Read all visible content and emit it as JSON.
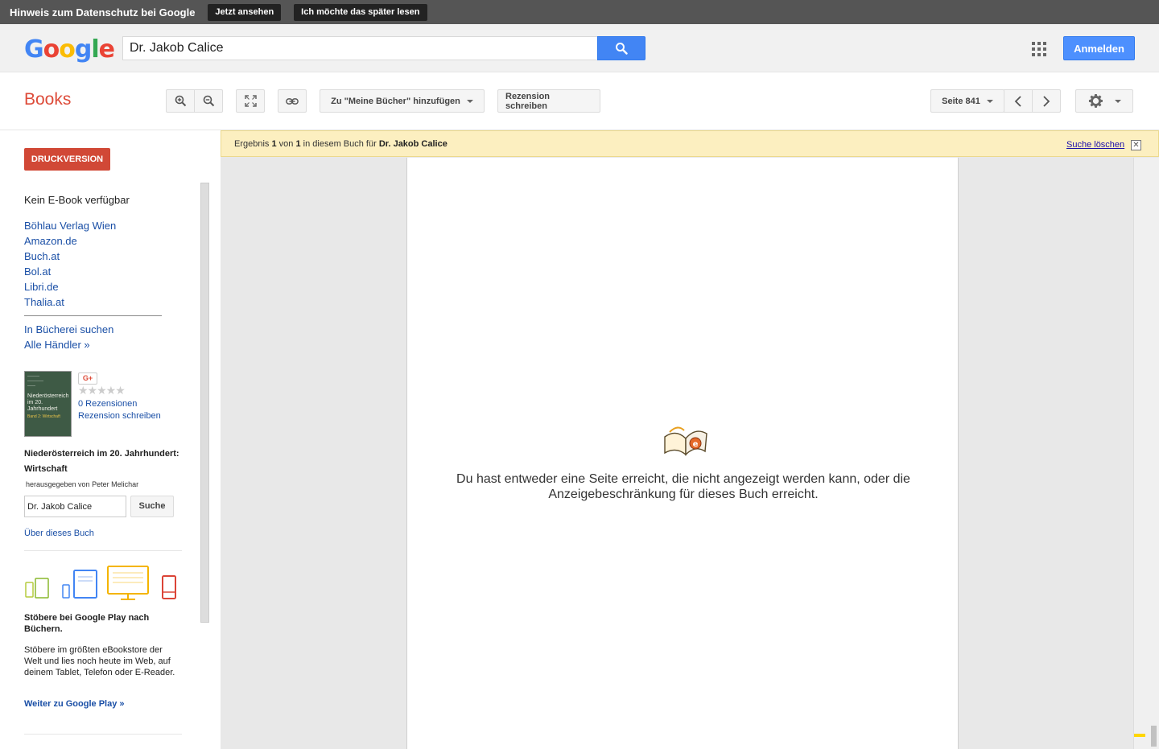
{
  "privacy": {
    "text": "Hinweis zum Datenschutz bei Google",
    "view_now": "Jetzt ansehen",
    "later": "Ich möchte das später lesen"
  },
  "header": {
    "logo": "Google",
    "search_value": "Dr. Jakob Calice",
    "signin": "Anmelden"
  },
  "toolbar": {
    "title": "Books",
    "add_to_library": "Zu \"Meine Bücher\" hinzufügen",
    "write_review": "Rezension schreiben",
    "page_select": "Seite 841"
  },
  "sidebar": {
    "print_version": "DRUCKVERSION",
    "no_ebook": "Kein E-Book verfügbar",
    "sellers": [
      "Böhlau Verlag Wien",
      "Amazon.de",
      "Buch.at",
      "Bol.at",
      "Libri.de",
      "Thalia.at"
    ],
    "library": [
      "In Bücherei suchen",
      "Alle Händler »"
    ],
    "cover": {
      "title": "Niederösterreich im 20. Jahrhundert",
      "subtitle": "Band 2: Wirtschaft"
    },
    "gplus": "G+",
    "stars": "★★★★★",
    "reviews_count": "0 Rezensionen",
    "write_review": "Rezension schreiben",
    "book_title": "Niederösterreich im 20. Jahrhundert: Wirtschaft",
    "editor": "herausgegeben von Peter Melichar",
    "inbook_search_value": "Dr. Jakob Calice",
    "inbook_search_button": "Suche",
    "about": "Über dieses Buch",
    "play_heading": "Stöbere bei Google Play nach Büchern.",
    "play_desc": "Stöbere im größten eBookstore der Welt und lies noch heute im Web, auf deinem Tablet, Telefon oder E-Reader.",
    "play_link": "Weiter zu Google Play »"
  },
  "viewer": {
    "result_prefix": "Ergebnis",
    "result_index": "1",
    "result_of": "von",
    "result_total": "1",
    "result_suffix": "in diesem Buch für",
    "result_query": "Dr. Jakob Calice",
    "clear_search": "Suche löschen",
    "message_line1": "Du hast entweder eine Seite erreicht, die nicht angezeigt werden kann, oder die",
    "message_line2": "Anzeigebeschränkung für dieses Buch erreicht."
  },
  "colors": {
    "books_red": "#dd4b39",
    "google_blue": "#4285f4",
    "result_bar": "#fcefc0"
  }
}
